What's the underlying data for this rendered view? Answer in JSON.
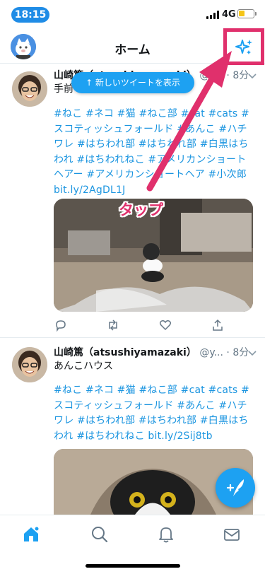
{
  "status_bar": {
    "time": "18:15",
    "network": "4G"
  },
  "header": {
    "title": "ホーム"
  },
  "new_tweets_button": "↑ 新しいツイートを表示",
  "annotation": {
    "label": "タップ"
  },
  "tweets": [
    {
      "name": "山崎篤（atsushiyamazaki）",
      "handle": "@y...",
      "time": "8分",
      "text": "手前",
      "tags": "#ねこ #ネコ #猫 #ねこ部 #cat #cats #スコティッシュフォールド #あんこ #ハチワレ #はちわれ部 #はちわれ部 #白黒はちわれ #はちわれねこ #アメリカンショートヘアー #アメリカンショートヘア #小次郎 bit.ly/2AgDL1J"
    },
    {
      "name": "山崎篤（atsushiyamazaki）",
      "handle": "@y...",
      "time": "8分",
      "text": "あんこハウス",
      "tags": "#ねこ #ネコ #猫 #ねこ部 #cat #cats #スコティッシュフォールド #あんこ #ハチワレ #はちわれ部 #はちわれ部 #白黒はちわれ #はちわれねこ bit.ly/2Sij8tb"
    }
  ],
  "colors": {
    "accent": "#1da1f2",
    "annotation": "#e0306c",
    "link": "#1b95e0"
  },
  "icons": {
    "nav": "sparkle-icon",
    "actions": [
      "reply-icon",
      "retweet-icon",
      "like-icon",
      "share-icon"
    ],
    "tabs": [
      "home-icon",
      "search-icon",
      "notifications-icon",
      "messages-icon"
    ],
    "fab": "compose-icon"
  }
}
